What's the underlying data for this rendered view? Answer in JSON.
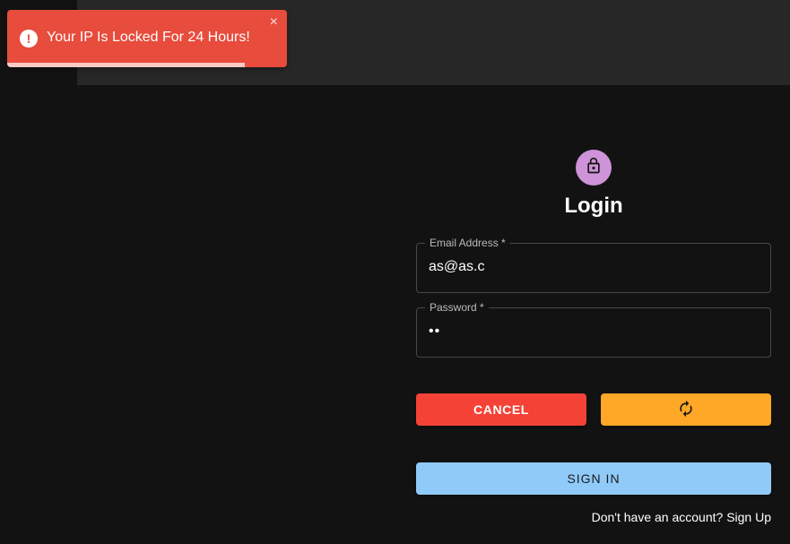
{
  "toast": {
    "message": "Your IP Is Locked For 24 Hours!",
    "close_symbol": "×",
    "icon": "alert-circle-icon",
    "color": "#e74c3c",
    "progress_fraction": 0.85
  },
  "login": {
    "icon": "lock-icon",
    "avatar_color": "#ce93d8",
    "title": "Login",
    "email": {
      "label": "Email Address *",
      "value": "as@as.c"
    },
    "password": {
      "label": "Password *",
      "masked_value": "••"
    },
    "buttons": {
      "cancel": "CANCEL",
      "cancel_color": "#f44336",
      "reset_icon": "refresh-icon",
      "reset_color": "#ffa726",
      "sign_in": "SIGN IN",
      "sign_in_color": "#90caf9"
    },
    "signup": {
      "prompt": "Don't have an account?",
      "link": "Sign Up"
    }
  }
}
